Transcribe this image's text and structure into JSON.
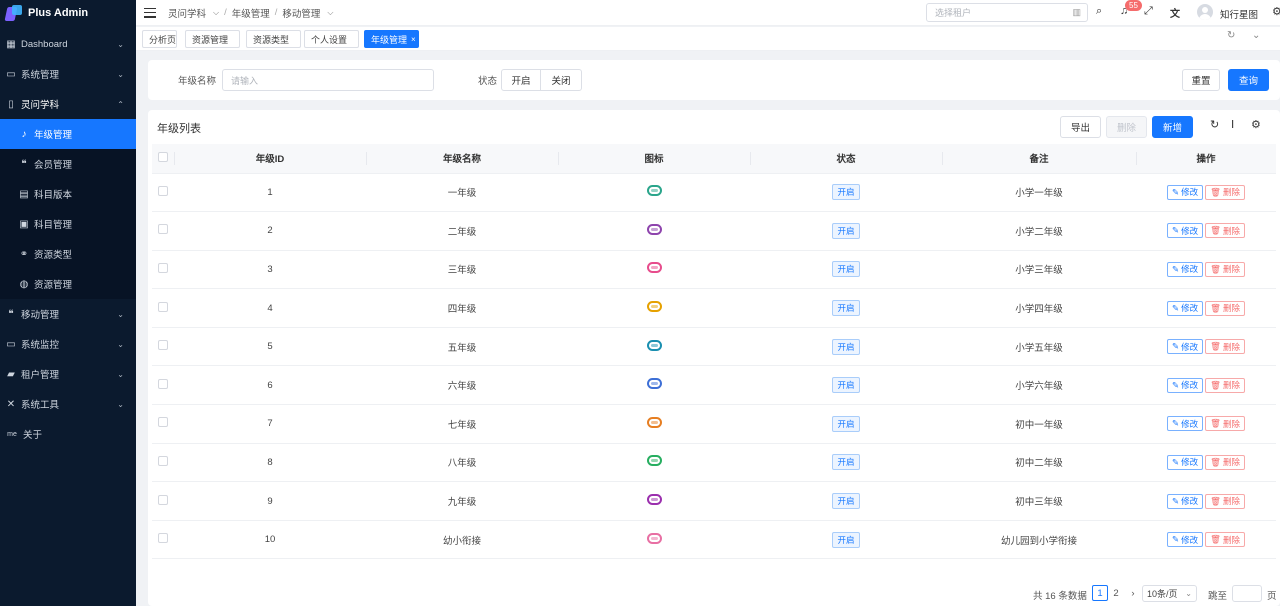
{
  "app": {
    "title": "Plus Admin"
  },
  "sidebar": {
    "items": [
      {
        "label": "Dashboard",
        "icon": "dashboard-icon",
        "arrow": "⌄"
      },
      {
        "label": "系统管理",
        "icon": "monitor-icon",
        "arrow": "⌄"
      },
      {
        "label": "灵问学科",
        "icon": "book-icon",
        "arrow": "⌃"
      },
      {
        "label": "年级管理",
        "icon": "microphone-icon",
        "arrow": ""
      },
      {
        "label": "会员管理",
        "icon": "chat-icon",
        "arrow": ""
      },
      {
        "label": "科目版本",
        "icon": "document-icon",
        "arrow": ""
      },
      {
        "label": "科目管理",
        "icon": "card-icon",
        "arrow": ""
      },
      {
        "label": "资源类型",
        "icon": "link-icon",
        "arrow": ""
      },
      {
        "label": "资源管理",
        "icon": "globe-icon",
        "arrow": ""
      },
      {
        "label": "移动管理",
        "icon": "chat-icon",
        "arrow": "⌄"
      },
      {
        "label": "系统监控",
        "icon": "monitor-icon",
        "arrow": "⌄"
      },
      {
        "label": "租户管理",
        "icon": "users-icon",
        "arrow": "⌄"
      },
      {
        "label": "系统工具",
        "icon": "tools-icon",
        "arrow": "⌄"
      },
      {
        "label": "关于",
        "icon": "me-icon",
        "arrow": ""
      }
    ]
  },
  "header": {
    "breadcrumb": [
      "灵问学科",
      "年级管理",
      "移动管理"
    ],
    "tenant_placeholder": "选择租户",
    "notification_count": "55",
    "username": "知行星图"
  },
  "tags": [
    "分析页",
    "资源管理",
    "资源类型",
    "个人设置",
    "年级管理"
  ],
  "search": {
    "grade_name_label": "年级名称",
    "grade_name_placeholder": "请输入",
    "status_label": "状态",
    "status_on": "开启",
    "status_off": "关闭",
    "reset": "重置",
    "query": "查询"
  },
  "table": {
    "title": "年级列表",
    "export": "导出",
    "delete": "删除",
    "add": "新增",
    "columns": [
      "年级ID",
      "年级名称",
      "图标",
      "状态",
      "备注",
      "操作"
    ],
    "edit_label": "修改",
    "delete_label": "删除",
    "rows": [
      {
        "id": "1",
        "name": "一年级",
        "status": "开启",
        "remark": "小学一年级",
        "icon_color": "#2aa58b"
      },
      {
        "id": "2",
        "name": "二年级",
        "status": "开启",
        "remark": "小学二年级",
        "icon_color": "#8e44ad"
      },
      {
        "id": "3",
        "name": "三年级",
        "status": "开启",
        "remark": "小学三年级",
        "icon_color": "#e74c8c"
      },
      {
        "id": "4",
        "name": "四年级",
        "status": "开启",
        "remark": "小学四年级",
        "icon_color": "#e6a100"
      },
      {
        "id": "5",
        "name": "五年级",
        "status": "开启",
        "remark": "小学五年级",
        "icon_color": "#1a8fb0"
      },
      {
        "id": "6",
        "name": "六年级",
        "status": "开启",
        "remark": "小学六年级",
        "icon_color": "#3d6fd6"
      },
      {
        "id": "7",
        "name": "七年级",
        "status": "开启",
        "remark": "初中一年级",
        "icon_color": "#e67e22"
      },
      {
        "id": "8",
        "name": "八年级",
        "status": "开启",
        "remark": "初中二年级",
        "icon_color": "#27ae60"
      },
      {
        "id": "9",
        "name": "九年级",
        "status": "开启",
        "remark": "初中三年级",
        "icon_color": "#9b2fae"
      },
      {
        "id": "10",
        "name": "幼小衔接",
        "status": "开启",
        "remark": "幼儿园到小学衔接",
        "icon_color": "#e86fa3"
      }
    ]
  },
  "pagination": {
    "total": "共 16 条数据",
    "pages": [
      "1",
      "2"
    ],
    "page_size": "10条/页",
    "jump": "跳至",
    "page_suffix": "页"
  }
}
